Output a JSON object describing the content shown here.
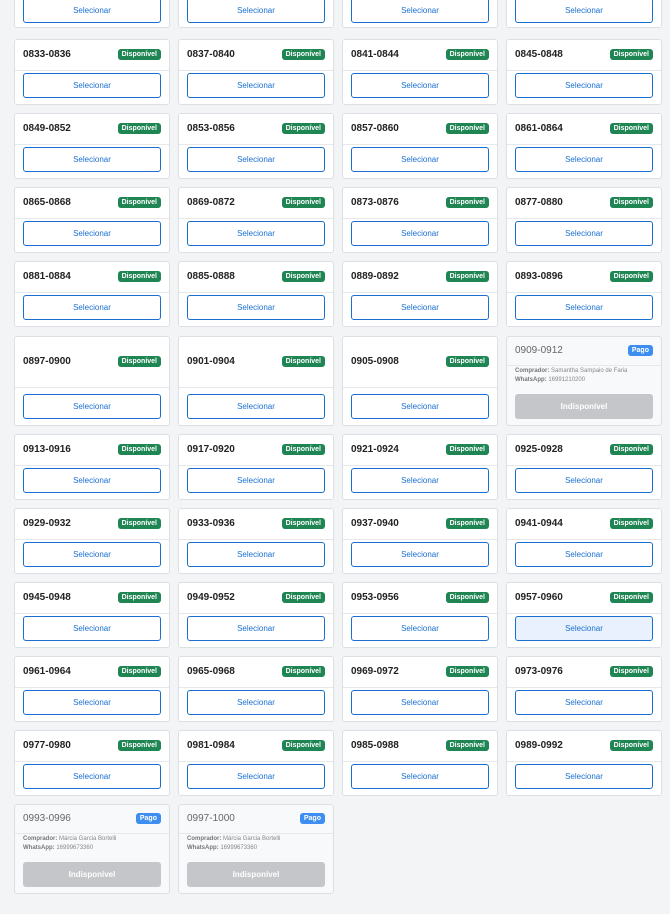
{
  "labels": {
    "available": "Disponível",
    "paid": "Pago",
    "select": "Selecionar",
    "unavailable": "Indisponível",
    "buyer": "Comprador:",
    "whatsapp": "WhatsApp:"
  },
  "colors": {
    "available_badge": "#1e8553",
    "paid_badge": "#3d8ef0",
    "primary": "#1a6fd1",
    "disabled_button": "#c4c6c9"
  },
  "rows": [
    {
      "cards": [
        {
          "range": "",
          "status": "available",
          "partial": true
        },
        {
          "range": "",
          "status": "available",
          "partial": true
        },
        {
          "range": "",
          "status": "available",
          "partial": true
        },
        {
          "range": "",
          "status": "available",
          "partial": true
        }
      ]
    },
    {
      "cards": [
        {
          "range": "0833-0836",
          "status": "available"
        },
        {
          "range": "0837-0840",
          "status": "available"
        },
        {
          "range": "0841-0844",
          "status": "available"
        },
        {
          "range": "0845-0848",
          "status": "available"
        }
      ]
    },
    {
      "cards": [
        {
          "range": "0849-0852",
          "status": "available"
        },
        {
          "range": "0853-0856",
          "status": "available"
        },
        {
          "range": "0857-0860",
          "status": "available"
        },
        {
          "range": "0861-0864",
          "status": "available"
        }
      ]
    },
    {
      "cards": [
        {
          "range": "0865-0868",
          "status": "available"
        },
        {
          "range": "0869-0872",
          "status": "available"
        },
        {
          "range": "0873-0876",
          "status": "available"
        },
        {
          "range": "0877-0880",
          "status": "available"
        }
      ]
    },
    {
      "cards": [
        {
          "range": "0881-0884",
          "status": "available"
        },
        {
          "range": "0885-0888",
          "status": "available"
        },
        {
          "range": "0889-0892",
          "status": "available"
        },
        {
          "range": "0893-0896",
          "status": "available"
        }
      ]
    },
    {
      "tall": true,
      "cards": [
        {
          "range": "0897-0900",
          "status": "available"
        },
        {
          "range": "0901-0904",
          "status": "available"
        },
        {
          "range": "0905-0908",
          "status": "available"
        },
        {
          "range": "0909-0912",
          "status": "paid",
          "buyer": "Samantha Sampaio de Faria",
          "whatsapp": "16991210200"
        }
      ]
    },
    {
      "cards": [
        {
          "range": "0913-0916",
          "status": "available"
        },
        {
          "range": "0917-0920",
          "status": "available"
        },
        {
          "range": "0921-0924",
          "status": "available"
        },
        {
          "range": "0925-0928",
          "status": "available"
        }
      ]
    },
    {
      "cards": [
        {
          "range": "0929-0932",
          "status": "available"
        },
        {
          "range": "0933-0936",
          "status": "available"
        },
        {
          "range": "0937-0940",
          "status": "available"
        },
        {
          "range": "0941-0944",
          "status": "available"
        }
      ]
    },
    {
      "cards": [
        {
          "range": "0945-0948",
          "status": "available"
        },
        {
          "range": "0949-0952",
          "status": "available"
        },
        {
          "range": "0953-0956",
          "status": "available"
        },
        {
          "range": "0957-0960",
          "status": "available",
          "hover": true
        }
      ]
    },
    {
      "cards": [
        {
          "range": "0961-0964",
          "status": "available"
        },
        {
          "range": "0965-0968",
          "status": "available"
        },
        {
          "range": "0969-0972",
          "status": "available"
        },
        {
          "range": "0973-0976",
          "status": "available"
        }
      ]
    },
    {
      "cards": [
        {
          "range": "0977-0980",
          "status": "available"
        },
        {
          "range": "0981-0984",
          "status": "available"
        },
        {
          "range": "0985-0988",
          "status": "available"
        },
        {
          "range": "0989-0992",
          "status": "available"
        }
      ]
    },
    {
      "tall": true,
      "cards": [
        {
          "range": "0993-0996",
          "status": "paid",
          "buyer": "Márcia Garcia Bortelli",
          "whatsapp": "16999673360"
        },
        {
          "range": "0997-1000",
          "status": "paid",
          "buyer": "Márcia Garcia Bortelli",
          "whatsapp": "16999673360"
        }
      ]
    }
  ]
}
